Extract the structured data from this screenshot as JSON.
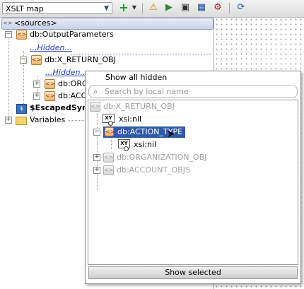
{
  "toolbar": {
    "map_selector": "XSLT map",
    "icons": [
      "add-icon",
      "chevron-down-icon",
      "warning-icon",
      "run-icon",
      "test-icon",
      "map-icon",
      "settings-icon",
      "refresh-icon"
    ]
  },
  "tree": {
    "sources_label": "<sources>",
    "output_parameters": "db:OutputParameters",
    "hidden_1": "...Hidden...",
    "return_obj": "db:X_RETURN_OBJ",
    "hidden_2": "...Hidden...",
    "child_org": "db:ORG",
    "child_acc": "db:ACCO",
    "escaped_sync": "$EscapedSync",
    "variables": "Variables"
  },
  "popup": {
    "title": "Show all hidden",
    "search_placeholder": "Search by local name",
    "items": {
      "return_obj": "db:X_RETURN_OBJ",
      "xsi_nil_1": "xsi:nil",
      "action_type": "db:ACTION_TYPE",
      "xsi_nil_2": "xsi:nil",
      "organization_obj": "db:ORGANIZATION_OBJ",
      "account_objs": "db:ACCOUNT_OBJS"
    },
    "show_selected": "Show selected"
  },
  "colors": {
    "selection": "#2f5aa8",
    "hidden_link": "#1f3fbf",
    "element_icon": "#f1b46c"
  }
}
